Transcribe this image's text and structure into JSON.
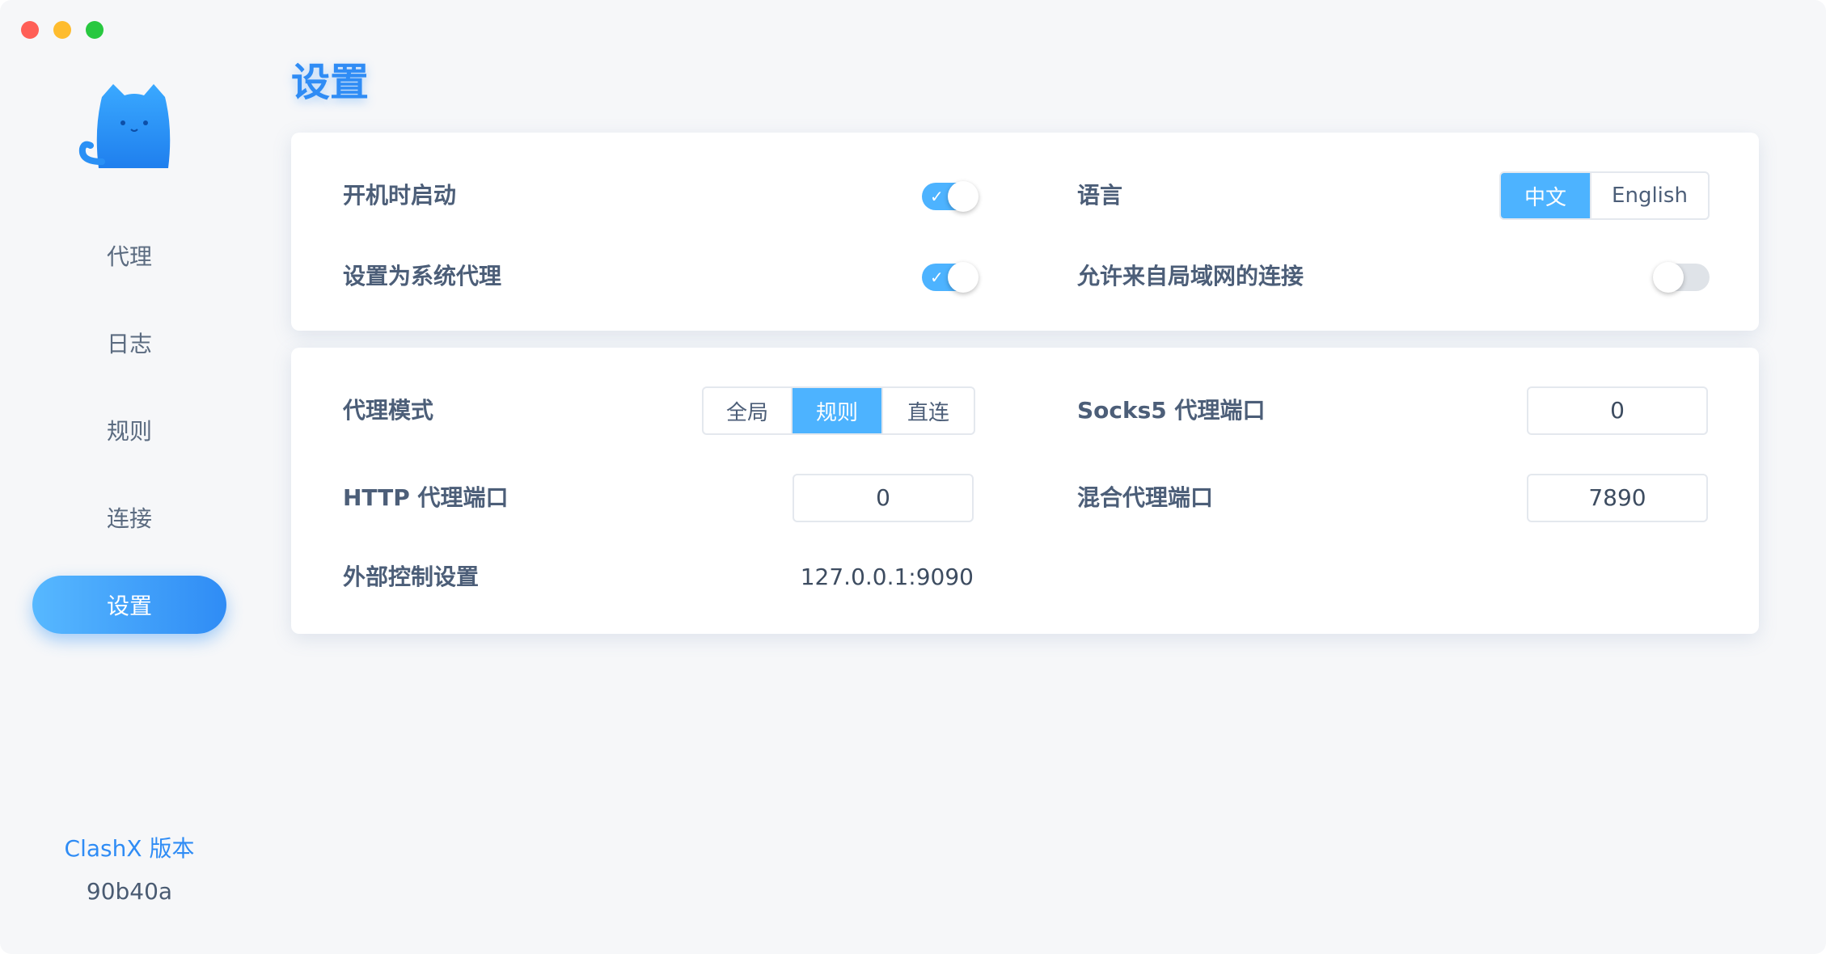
{
  "window": {
    "buttons": [
      "close",
      "minimize",
      "zoom"
    ]
  },
  "sidebar": {
    "logo_icon": "cat-icon",
    "items": [
      {
        "label": "代理",
        "active": false
      },
      {
        "label": "日志",
        "active": false
      },
      {
        "label": "规则",
        "active": false
      },
      {
        "label": "连接",
        "active": false
      },
      {
        "label": "设置",
        "active": true
      }
    ],
    "version_label": "ClashX 版本",
    "version_hash": "90b40a"
  },
  "page": {
    "title": "设置"
  },
  "general": {
    "start_at_login": {
      "label": "开机时启动",
      "enabled": true
    },
    "system_proxy": {
      "label": "设置为系统代理",
      "enabled": true
    },
    "language": {
      "label": "语言",
      "options": [
        "中文",
        "English"
      ],
      "selected": "中文"
    },
    "allow_lan": {
      "label": "允许来自局域网的连接",
      "enabled": false
    }
  },
  "proxy": {
    "mode": {
      "label": "代理模式",
      "options": [
        "全局",
        "规则",
        "直连"
      ],
      "selected": "规则"
    },
    "socks5_port": {
      "label": "Socks5 代理端口",
      "value": "0"
    },
    "http_port": {
      "label": "HTTP 代理端口",
      "value": "0"
    },
    "mixed_port": {
      "label": "混合代理端口",
      "value": "7890"
    },
    "external_controller": {
      "label": "外部控制设置",
      "value": "127.0.0.1:9090"
    }
  },
  "colors": {
    "accent": "#2f8cf5",
    "toggle_on": "#4db3ff",
    "toggle_off": "#dfe3e8",
    "active_nav_start": "#57b8ff",
    "active_nav_end": "#2f8cf5",
    "label_text": "#4c5e78",
    "window_bg": "#f6f7f9"
  }
}
